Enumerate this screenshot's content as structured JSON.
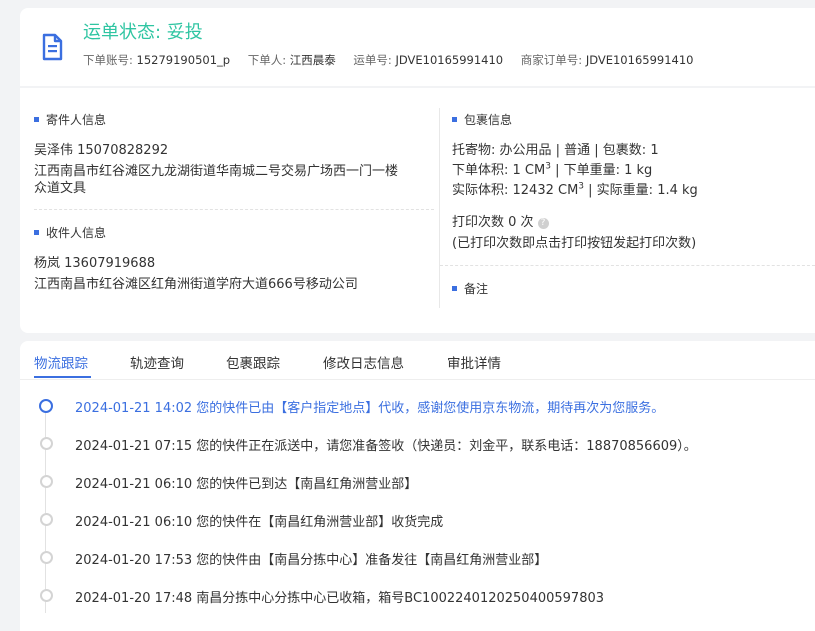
{
  "header": {
    "status_label": "运单状态: 妥投",
    "waybill_account_key": "下单账号:",
    "waybill_account_val": "15279190501_p",
    "orderer_key": "下单人:",
    "orderer_val": "江西晨泰",
    "waybill_no_key": "运单号:",
    "waybill_no_val": "JDVE10165991410",
    "merchant_order_key": "商家订单号:",
    "merchant_order_val": "JDVE10165991410"
  },
  "sender": {
    "title": "寄件人信息",
    "name_phone": "吴泽伟   15070828292",
    "address_line1": "江西南昌市红谷滩区九龙湖街道华南城二号交易广场西一门一楼",
    "address_line2": "众道文具"
  },
  "receiver": {
    "title": "收件人信息",
    "name_phone": "杨岚   13607919688",
    "address": "江西南昌市红谷滩区红角洲街道学府大道666号移动公司"
  },
  "package": {
    "title": "包裹信息",
    "line1": "托寄物:  办公用品 | 普通  |  包裹数:  1",
    "volume_label": "下单体积:    1 CM",
    "volume_sup": "3",
    "weight_label": "  |  下单重量:   1 kg",
    "actual_volume_label": "实际体积:    12432 CM",
    "actual_volume_sup": "3",
    "actual_weight_label": "  |  实际重量:   1.4 kg",
    "print_count": "打印次数    0 次",
    "help_glyph": "?",
    "print_hint": "(已打印次数即点击打印按钮发起打印次数)"
  },
  "remark": {
    "title": "备注"
  },
  "tabs": [
    {
      "label": "物流跟踪"
    },
    {
      "label": "轨迹查询"
    },
    {
      "label": "包裹跟踪"
    },
    {
      "label": "修改日志信息"
    },
    {
      "label": "审批详情"
    }
  ],
  "timeline": [
    {
      "text": "2024-01-21 14:02  您的快件已由【客户指定地点】代收，感谢您使用京东物流，期待再次为您服务。"
    },
    {
      "text": "2024-01-21 07:15  您的快件正在派送中，请您准备签收（快递员：刘金平，联系电话：18870856609）。"
    },
    {
      "text": "2024-01-21 06:10  您的快件已到达【南昌红角洲营业部】"
    },
    {
      "text": "2024-01-21 06:10  您的快件在【南昌红角洲营业部】收货完成"
    },
    {
      "text": "2024-01-20 17:53  您的快件由【南昌分拣中心】准备发往【南昌红角洲营业部】"
    },
    {
      "text": "2024-01-20 17:48  南昌分拣中心分拣中心已收箱，箱号BC1002240120250400597803"
    }
  ],
  "colors": {
    "accent": "#3b6fe0",
    "status_green": "#2fc5a2"
  }
}
